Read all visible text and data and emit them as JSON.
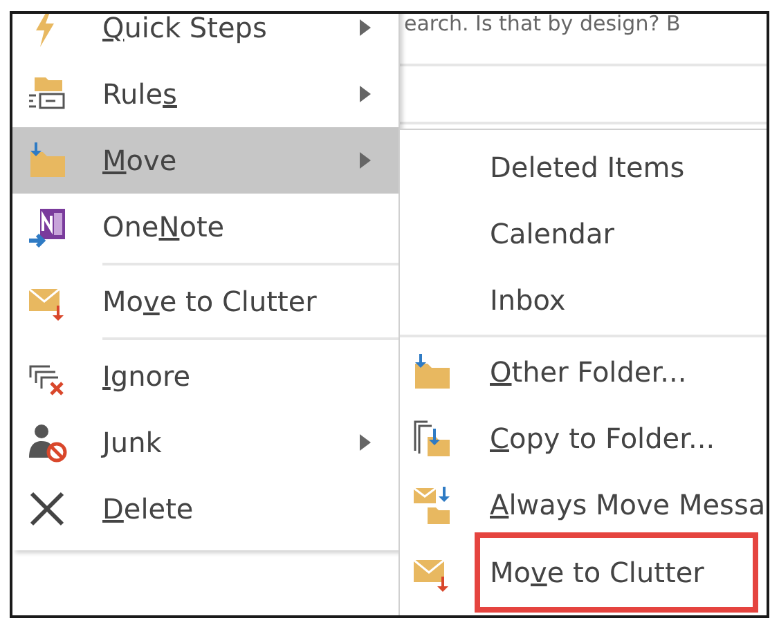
{
  "background": {
    "preview_text": "earch. Is that by design? B"
  },
  "context_menu": {
    "items": [
      {
        "kind": "item",
        "access_key": "Q",
        "text_after": "uick Steps",
        "has_submenu": true,
        "selected": false
      },
      {
        "kind": "item",
        "text_before": "Rule",
        "access_key": "s",
        "has_submenu": true,
        "selected": false
      },
      {
        "kind": "item",
        "access_key": "M",
        "text_after": "ove",
        "has_submenu": true,
        "selected": true
      },
      {
        "kind": "item",
        "text_before": "One",
        "access_key": "N",
        "text_after": "ote",
        "has_submenu": false,
        "selected": false
      },
      {
        "kind": "separator"
      },
      {
        "kind": "item",
        "text_before": "Mo",
        "access_key": "v",
        "text_after": "e to Clutter",
        "has_submenu": false,
        "selected": false
      },
      {
        "kind": "separator"
      },
      {
        "kind": "item",
        "access_key": "I",
        "text_after": "gnore",
        "has_submenu": false,
        "selected": false
      },
      {
        "kind": "item",
        "access_key": "J",
        "text_after": "unk",
        "has_submenu": true,
        "selected": false
      },
      {
        "kind": "item",
        "access_key": "D",
        "text_after": "elete",
        "has_submenu": false,
        "selected": false
      }
    ]
  },
  "submenu": {
    "items": [
      {
        "kind": "item",
        "text_before": "Deleted Items",
        "highlighted": false
      },
      {
        "kind": "item",
        "text_before": "Calendar",
        "highlighted": false
      },
      {
        "kind": "item",
        "text_before": "Inbox",
        "highlighted": false
      },
      {
        "kind": "separator"
      },
      {
        "kind": "item",
        "access_key": "O",
        "text_after": "ther Folder...",
        "highlighted": false
      },
      {
        "kind": "item",
        "access_key": "C",
        "text_after": "opy to Folder...",
        "highlighted": false
      },
      {
        "kind": "item",
        "access_key": "A",
        "text_after": "lways Move Messa",
        "highlighted": false
      },
      {
        "kind": "item",
        "text_before": "Mo",
        "access_key": "v",
        "text_after": "e to Clutter",
        "highlighted": true
      }
    ]
  }
}
